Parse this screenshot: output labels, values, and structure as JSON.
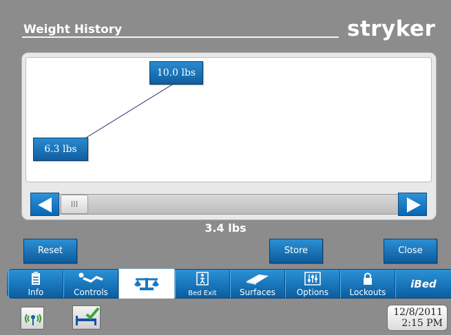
{
  "header": {
    "title": "Weight History",
    "brand": "stryker"
  },
  "chart_data": {
    "type": "line",
    "x": [
      "1",
      "2"
    ],
    "values": [
      6.3,
      10.0
    ],
    "point_labels": [
      "6.3 lbs",
      "10.0 lbs"
    ],
    "ylim": [
      5.5,
      10.6
    ],
    "line_color": "#2a2a6a",
    "grid": false
  },
  "slider": {
    "thumb_glyph": "III",
    "left_icon": "arrow-left-icon",
    "right_icon": "arrow-right-icon"
  },
  "readout": {
    "weight": "3.4 lbs"
  },
  "actions": {
    "reset": "Reset",
    "store": "Store",
    "close": "Close"
  },
  "nav": {
    "tabs": [
      {
        "label": "Info",
        "icon": "clipboard-icon"
      },
      {
        "label": "Controls",
        "icon": "patient-position-icon"
      },
      {
        "label": "",
        "icon": "scale-icon",
        "active": true
      },
      {
        "label": "Bed Exit",
        "icon": "bed-exit-icon"
      },
      {
        "label": "Surfaces",
        "icon": "mattress-icon"
      },
      {
        "label": "Options",
        "icon": "sliders-icon"
      },
      {
        "label": "Lockouts",
        "icon": "lock-icon"
      },
      {
        "label": "iBed",
        "icon": "ibed-icon"
      }
    ]
  },
  "footer": {
    "date": "12/8/2011",
    "time": "2:15 PM",
    "wifi_icon": "wireless-icon",
    "bed_status_icon": "bed-check-icon"
  },
  "colors": {
    "accent": "#1a78c2",
    "background": "#8c8c8c",
    "check": "#3aa83a"
  }
}
